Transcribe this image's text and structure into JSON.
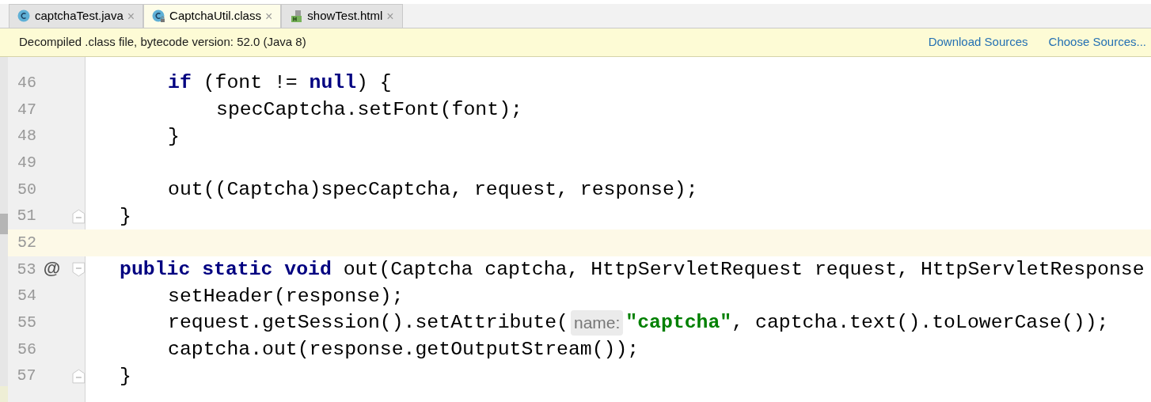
{
  "tabs": [
    {
      "label": "captchaTest.java",
      "selected": false,
      "close": "×"
    },
    {
      "label": "CaptchaUtil.class",
      "selected": true,
      "close": "×"
    },
    {
      "label": "showTest.html",
      "selected": false,
      "close": "×"
    }
  ],
  "banner": {
    "message": "Decompiled .class file, bytecode version: 52.0 (Java 8)",
    "links": [
      "Download Sources",
      "Choose Sources..."
    ]
  },
  "editor": {
    "lines": [
      {
        "kind": "context",
        "children": [
          {
            "number": "46",
            "current": false,
            "tokens": [
              {
                "kind": "keyword",
                "text": "if"
              },
              {
                "kind": "plain",
                "text": " (font != "
              },
              {
                "kind": "keyword",
                "text": "null"
              },
              {
                "kind": "plain",
                "text": ") {"
              }
            ],
            "children": [
              {
                "number": "47",
                "current": false,
                "tokens": [
                  {
                    "kind": "plain",
                    "text": "specCaptcha.setFont(font);"
                  }
                ]
              }
            ]
          },
          {
            "number": "48",
            "current": false,
            "tokens": [
              {
                "kind": "plain",
                "text": "}"
              }
            ]
          },
          {
            "number": "49",
            "current": false
          },
          {
            "number": "50",
            "current": false,
            "tokens": [
              {
                "kind": "plain",
                "text": "out((Captcha)specCaptcha, request, response);"
              }
            ]
          }
        ]
      },
      {
        "number": "51",
        "kind": "closer",
        "current": false,
        "tokens": [
          {
            "kind": "plain",
            "text": "}"
          }
        ]
      },
      {
        "number": "52",
        "current": true
      },
      {
        "number": "53",
        "kind": "opener",
        "current": false,
        "marker": "@",
        "tokens": [
          {
            "kind": "keyword",
            "text": "public static void"
          },
          {
            "kind": "plain",
            "text": " out(Captcha captcha, HttpServletRequest request, HttpServletResponse"
          }
        ],
        "children": [
          {
            "number": "54",
            "current": false,
            "tokens": [
              {
                "kind": "plain",
                "text": "setHeader(response);"
              }
            ]
          },
          {
            "number": "55",
            "current": false,
            "tokens": [
              {
                "kind": "plain",
                "text": "request.getSession().setAttribute("
              },
              {
                "kind": "hint",
                "text": "name:"
              },
              {
                "kind": "string",
                "text": "\"captcha\""
              },
              {
                "kind": "plain",
                "text": ", captcha.text().toLowerCase());"
              }
            ]
          },
          {
            "number": "56",
            "current": false,
            "tokens": [
              {
                "kind": "plain",
                "text": "captcha.out(response.getOutputStream());"
              }
            ]
          }
        ]
      },
      {
        "number": "57",
        "kind": "closer",
        "current": false,
        "tokens": [
          {
            "kind": "plain",
            "text": "}"
          }
        ]
      }
    ]
  }
}
